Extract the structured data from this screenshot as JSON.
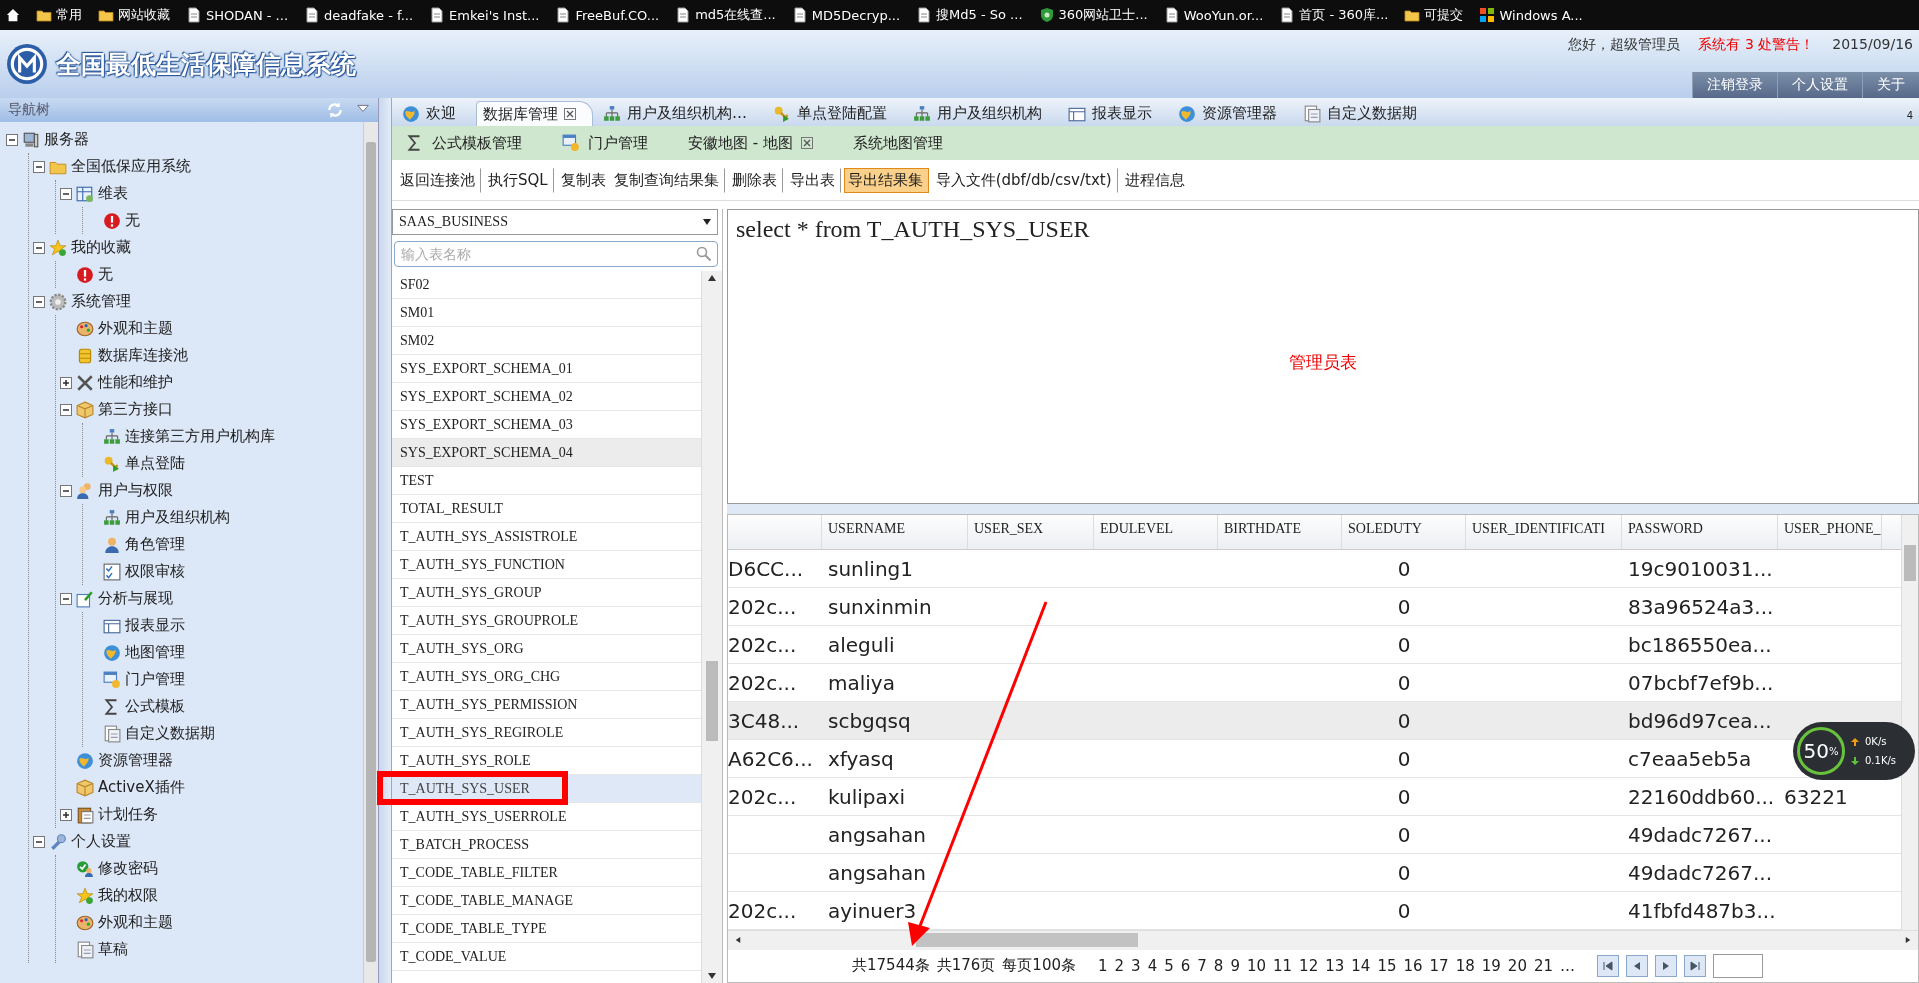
{
  "bookmarks": [
    {
      "label": "常用",
      "kind": "folder"
    },
    {
      "label": "网站收藏",
      "kind": "folder"
    },
    {
      "label": "SHODAN - ...",
      "kind": "page"
    },
    {
      "label": "deadfake - f...",
      "kind": "page"
    },
    {
      "label": "Emkei's Inst...",
      "kind": "page"
    },
    {
      "label": "FreeBuf.CO...",
      "kind": "page"
    },
    {
      "label": "md5在线查...",
      "kind": "page"
    },
    {
      "label": "MD5Decryp...",
      "kind": "page"
    },
    {
      "label": "搜Md5 - So ...",
      "kind": "page"
    },
    {
      "label": "360网站卫士...",
      "kind": "shield"
    },
    {
      "label": "WooYun.or...",
      "kind": "page"
    },
    {
      "label": "首页 - 360库...",
      "kind": "page"
    },
    {
      "label": "可提交",
      "kind": "folder"
    },
    {
      "label": "Windows A...",
      "kind": "windows"
    }
  ],
  "header": {
    "title": "全国最低生活保障信息系统",
    "greeting": "您好，超级管理员",
    "warning": "系统有 3 处警告！",
    "date": "2015/09/16",
    "nav": [
      "注销登录",
      "个人设置",
      "关于"
    ]
  },
  "sidebar": {
    "title": "导航树",
    "tree": [
      {
        "label": "服务器",
        "kind": "computer",
        "expanded": true,
        "children": [
          {
            "label": "全国低保应用系统",
            "kind": "folder",
            "expanded": true,
            "children": [
              {
                "label": "维表",
                "kind": "table",
                "expanded": true,
                "children": [
                  {
                    "label": "无",
                    "kind": "alert"
                  }
                ]
              }
            ]
          },
          {
            "label": "我的收藏",
            "kind": "star",
            "expanded": true,
            "children": [
              {
                "label": "无",
                "kind": "alert"
              }
            ]
          },
          {
            "label": "系统管理",
            "kind": "gear",
            "expanded": true,
            "children": [
              {
                "label": "外观和主题",
                "kind": "palette"
              },
              {
                "label": "数据库连接池",
                "kind": "database"
              },
              {
                "label": "性能和维护",
                "kind": "tools",
                "expanded": false
              },
              {
                "label": "第三方接口",
                "kind": "box",
                "expanded": true,
                "children": [
                  {
                    "label": "连接第三方用户机构库",
                    "kind": "network"
                  },
                  {
                    "label": "单点登陆",
                    "kind": "key"
                  }
                ]
              },
              {
                "label": "用户与权限",
                "kind": "users",
                "expanded": true,
                "children": [
                  {
                    "label": "用户及组织机构",
                    "kind": "network"
                  },
                  {
                    "label": "角色管理",
                    "kind": "user"
                  },
                  {
                    "label": "权限审核",
                    "kind": "checklist"
                  }
                ]
              },
              {
                "label": "分析与展现",
                "kind": "pin",
                "expanded": true,
                "children": [
                  {
                    "label": "报表显示",
                    "kind": "report"
                  },
                  {
                    "label": "地图管理",
                    "kind": "globe"
                  },
                  {
                    "label": "门户管理",
                    "kind": "window"
                  },
                  {
                    "label": "公式模板",
                    "kind": "sigma"
                  },
                  {
                    "label": "自定义数据期",
                    "kind": "document"
                  }
                ]
              },
              {
                "label": "资源管理器",
                "kind": "globe"
              },
              {
                "label": "ActiveX插件",
                "kind": "box"
              },
              {
                "label": "计划任务",
                "kind": "clipboard",
                "expanded": false
              }
            ]
          },
          {
            "label": "个人设置",
            "kind": "wrench",
            "expanded": true,
            "children": [
              {
                "label": "修改密码",
                "kind": "check"
              },
              {
                "label": "我的权限",
                "kind": "star"
              },
              {
                "label": "外观和主题",
                "kind": "palette"
              },
              {
                "label": "草稿",
                "kind": "document"
              }
            ]
          }
        ]
      }
    ]
  },
  "tabs": [
    {
      "label": "欢迎",
      "kind": "globe",
      "selected": false,
      "closable": false
    },
    {
      "label": "数据库管理",
      "selected": true,
      "closable": true
    },
    {
      "label": "用户及组织机构…",
      "kind": "network",
      "selected": false,
      "closable": false
    },
    {
      "label": "单点登陆配置",
      "kind": "key",
      "selected": false,
      "closable": false
    },
    {
      "label": "用户及组织机构",
      "kind": "network",
      "selected": false,
      "closable": false
    },
    {
      "label": "报表显示",
      "kind": "report",
      "selected": false,
      "closable": false
    },
    {
      "label": "资源管理器",
      "kind": "globe",
      "selected": false,
      "closable": false
    },
    {
      "label": "自定义数据期",
      "kind": "document",
      "selected": false,
      "closable": false
    }
  ],
  "tab_count": "4",
  "subtabs": [
    {
      "label": "公式模板管理",
      "kind": "sigma",
      "closable": false
    },
    {
      "label": "门户管理",
      "kind": "window",
      "closable": false
    },
    {
      "label": "安徽地图 - 地图",
      "closable": true
    },
    {
      "label": "系统地图管理",
      "closable": false
    }
  ],
  "toolbar": [
    {
      "label": "返回连接池",
      "highlighted": false,
      "divider": true
    },
    {
      "label": "执行SQL",
      "highlighted": false,
      "divider": true
    },
    {
      "label": "复制表",
      "highlighted": false,
      "divider": false
    },
    {
      "label": "复制查询结果集",
      "highlighted": false,
      "divider": true
    },
    {
      "label": "删除表",
      "highlighted": false,
      "divider": true
    },
    {
      "label": "导出表",
      "highlighted": false,
      "divider": true
    },
    {
      "label": "导出结果集",
      "highlighted": true,
      "divider": true
    },
    {
      "label": "导入文件(dbf/db/csv/txt)",
      "highlighted": false,
      "divider": true
    },
    {
      "label": "进程信息",
      "highlighted": false,
      "divider": false
    }
  ],
  "schema_select": {
    "value": "SAAS_BUSINESS"
  },
  "table_search": {
    "placeholder": "输入表名称"
  },
  "tables": [
    {
      "name": "SF02",
      "selected": false,
      "hovered": false
    },
    {
      "name": "SM01",
      "selected": false,
      "hovered": false
    },
    {
      "name": "SM02",
      "selected": false,
      "hovered": false
    },
    {
      "name": "SYS_EXPORT_SCHEMA_01",
      "selected": false,
      "hovered": false
    },
    {
      "name": "SYS_EXPORT_SCHEMA_02",
      "selected": false,
      "hovered": false
    },
    {
      "name": "SYS_EXPORT_SCHEMA_03",
      "selected": false,
      "hovered": false
    },
    {
      "name": "SYS_EXPORT_SCHEMA_04",
      "selected": false,
      "hovered": true
    },
    {
      "name": "TEST",
      "selected": false,
      "hovered": false
    },
    {
      "name": "TOTAL_RESULT",
      "selected": false,
      "hovered": false
    },
    {
      "name": "T_AUTH_SYS_ASSISTROLE",
      "selected": false,
      "hovered": false
    },
    {
      "name": "T_AUTH_SYS_FUNCTION",
      "selected": false,
      "hovered": false
    },
    {
      "name": "T_AUTH_SYS_GROUP",
      "selected": false,
      "hovered": false
    },
    {
      "name": "T_AUTH_SYS_GROUPROLE",
      "selected": false,
      "hovered": false
    },
    {
      "name": "T_AUTH_SYS_ORG",
      "selected": false,
      "hovered": false
    },
    {
      "name": "T_AUTH_SYS_ORG_CHG",
      "selected": false,
      "hovered": false
    },
    {
      "name": "T_AUTH_SYS_PERMISSION",
      "selected": false,
      "hovered": false
    },
    {
      "name": "T_AUTH_SYS_REGIROLE",
      "selected": false,
      "hovered": false
    },
    {
      "name": "T_AUTH_SYS_ROLE",
      "selected": false,
      "hovered": false
    },
    {
      "name": "T_AUTH_SYS_USER",
      "selected": true,
      "hovered": false
    },
    {
      "name": "T_AUTH_SYS_USERROLE",
      "selected": false,
      "hovered": false
    },
    {
      "name": "T_BATCH_PROCESS",
      "selected": false,
      "hovered": false
    },
    {
      "name": "T_CODE_TABLE_FILTER",
      "selected": false,
      "hovered": false
    },
    {
      "name": "T_CODE_TABLE_MANAGE",
      "selected": false,
      "hovered": false
    },
    {
      "name": "T_CODE_TABLE_TYPE",
      "selected": false,
      "hovered": false
    },
    {
      "name": "T_CODE_VALUE",
      "selected": false,
      "hovered": false
    }
  ],
  "sql_editor": {
    "value": "select * from T_AUTH_SYS_USER",
    "annotation": "管理员表"
  },
  "result_grid": {
    "columns": [
      "USERNAME",
      "USER_SEX",
      "EDULEVEL",
      "BIRTHDATE",
      "SOLEDUTY",
      "USER_IDENTIFICATI",
      "PASSWORD",
      "USER_PHONE_"
    ],
    "rows": [
      {
        "column_1": "D6CC...",
        "username": "sunling1",
        "soleduty": "0",
        "password": "19c9010031...",
        "selected": false
      },
      {
        "column_1": "202c...",
        "username": "sunxinmin",
        "soleduty": "0",
        "password": "83a96524a3...",
        "selected": false
      },
      {
        "column_1": "202c...",
        "username": "aleguli",
        "soleduty": "0",
        "password": "bc186550ea...",
        "selected": false
      },
      {
        "column_1": "202c...",
        "username": "maliya",
        "soleduty": "0",
        "password": "07bcbf7ef9b...",
        "selected": false
      },
      {
        "column_1": "3C48...",
        "username": "scbgqsq",
        "soleduty": "0",
        "password": "bd96d97cea...",
        "selected": true
      },
      {
        "column_1": "A62C6...",
        "username": "xfyasq",
        "soleduty": "0",
        "password": "c7eaa5eb5a",
        "selected": false
      },
      {
        "column_1": "202c...",
        "username": "kulipaxi",
        "soleduty": "0",
        "password": "22160ddb60...",
        "user_phone": "63221",
        "selected": false
      },
      {
        "username": "angsahan",
        "soleduty": "0",
        "password": "49dadc7267...",
        "selected": false
      },
      {
        "username": "angsahan",
        "soleduty": "0",
        "password": "49dadc7267...",
        "selected": false
      },
      {
        "column_1": "202c...",
        "username": "ayinuer3",
        "soleduty": "0",
        "password": "41fbfd487b3...",
        "selected": false
      }
    ]
  },
  "pagination": {
    "total_records": "共17544条",
    "total_pages": "共176页",
    "page_size": "每页100条",
    "pages": [
      "1",
      "2",
      "3",
      "4",
      "5",
      "6",
      "7",
      "8",
      "9",
      "10",
      "11",
      "12",
      "13",
      "14",
      "15",
      "16",
      "17",
      "18",
      "19",
      "20",
      "21"
    ],
    "more": "…"
  },
  "net_widget": {
    "percent": "50",
    "unit": "%",
    "upload": "0K/s",
    "download": "0.1K/s"
  }
}
